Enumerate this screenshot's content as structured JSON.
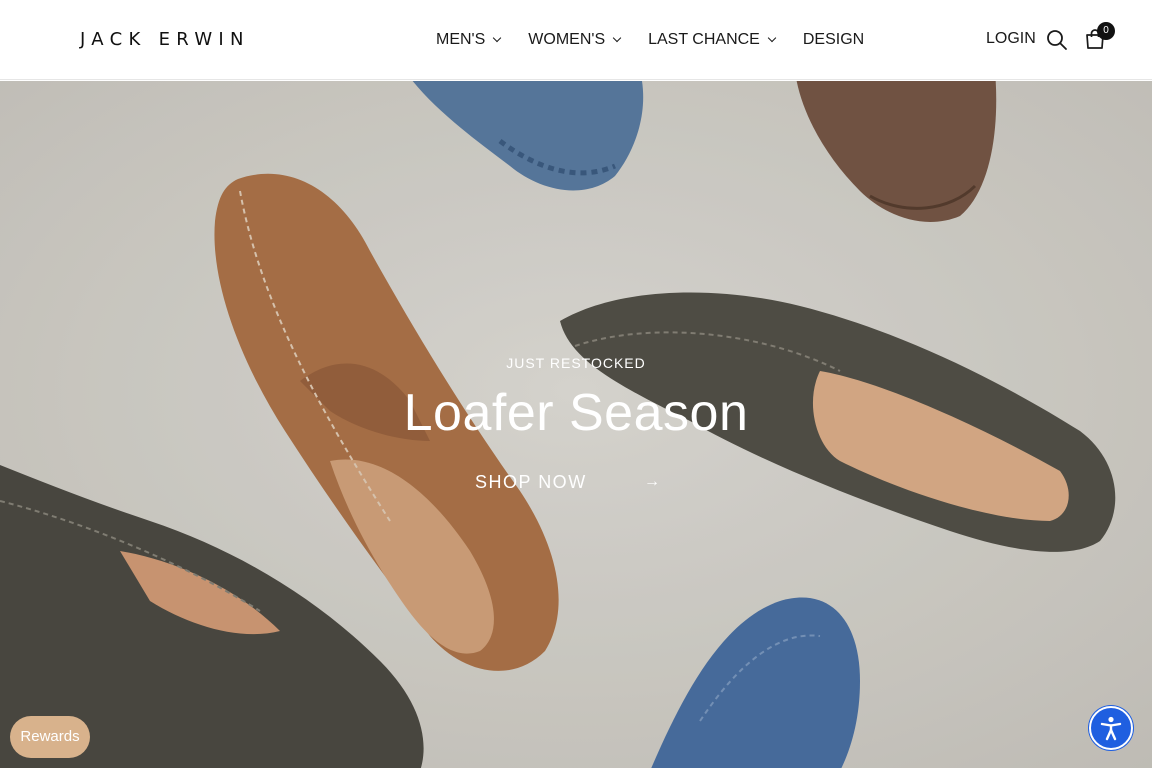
{
  "header": {
    "logo": "JACK ERWIN",
    "nav": [
      {
        "label": "MEN'S",
        "has_dropdown": true
      },
      {
        "label": "WOMEN'S",
        "has_dropdown": true
      },
      {
        "label": "LAST CHANCE",
        "has_dropdown": true
      },
      {
        "label": "DESIGN",
        "has_dropdown": false
      }
    ],
    "login_label": "LOGIN",
    "search_icon": "search-icon",
    "cart_icon": "shopping-bag-icon",
    "cart_count": "0"
  },
  "hero": {
    "eyebrow": "JUST RESTOCKED",
    "title": "Loafer Season",
    "cta_label": "SHOP NOW",
    "cta_arrow": "→",
    "background_description_icon": "loafers-photo"
  },
  "widgets": {
    "rewards_label": "Rewards",
    "accessibility_icon": "accessibility-icon"
  },
  "colors": {
    "header_bg": "#ffffff",
    "text": "#1a1a1a",
    "rewards_bg": "#d8b28c",
    "accessibility_bg": "#1f5fe0",
    "hero_bg": "#dcdad4"
  }
}
